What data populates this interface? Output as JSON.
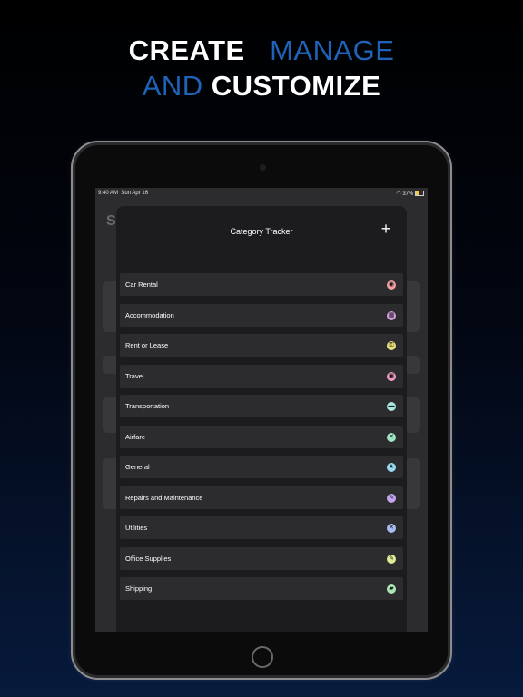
{
  "headline": {
    "line1_word1": "CREATE",
    "line1_word2": "MANAGE",
    "line2_word1": "AND",
    "line2_word2": "CUSTOMIZE"
  },
  "status_bar": {
    "time": "9:40 AM",
    "date": "Sun Apr 16",
    "battery": "37%",
    "wifi_icon": "wifi-icon"
  },
  "background_page": {
    "title": "S"
  },
  "modal": {
    "title": "Category Tracker",
    "add_icon": "plus-icon",
    "add_symbol": "+"
  },
  "categories": [
    {
      "label": "Car Rental",
      "color": "#f2a0a0",
      "icon": "car-icon",
      "glyph": "◉"
    },
    {
      "label": "Accommodation",
      "color": "#d59be0",
      "icon": "bed-icon",
      "glyph": "▦"
    },
    {
      "label": "Rent or Lease",
      "color": "#e8e27a",
      "icon": "key-icon",
      "glyph": "⚿"
    },
    {
      "label": "Travel",
      "color": "#f29cc4",
      "icon": "suitcase-icon",
      "glyph": "▣"
    },
    {
      "label": "Transportation",
      "color": "#a9e7de",
      "icon": "bus-icon",
      "glyph": "▬"
    },
    {
      "label": "Airfare",
      "color": "#9fe3c3",
      "icon": "plane-icon",
      "glyph": "✕"
    },
    {
      "label": "General",
      "color": "#98d8ef",
      "icon": "star-icon",
      "glyph": "★"
    },
    {
      "label": "Repairs and Maintenance",
      "color": "#c4a4f0",
      "icon": "wrench-icon",
      "glyph": "✎"
    },
    {
      "label": "Utilities",
      "color": "#a7bdf2",
      "icon": "tools-icon",
      "glyph": "✕"
    },
    {
      "label": "Office Supplies",
      "color": "#dbec94",
      "icon": "pencil-icon",
      "glyph": "✎"
    },
    {
      "label": "Shipping",
      "color": "#a8e6b8",
      "icon": "truck-icon",
      "glyph": "▰"
    }
  ]
}
